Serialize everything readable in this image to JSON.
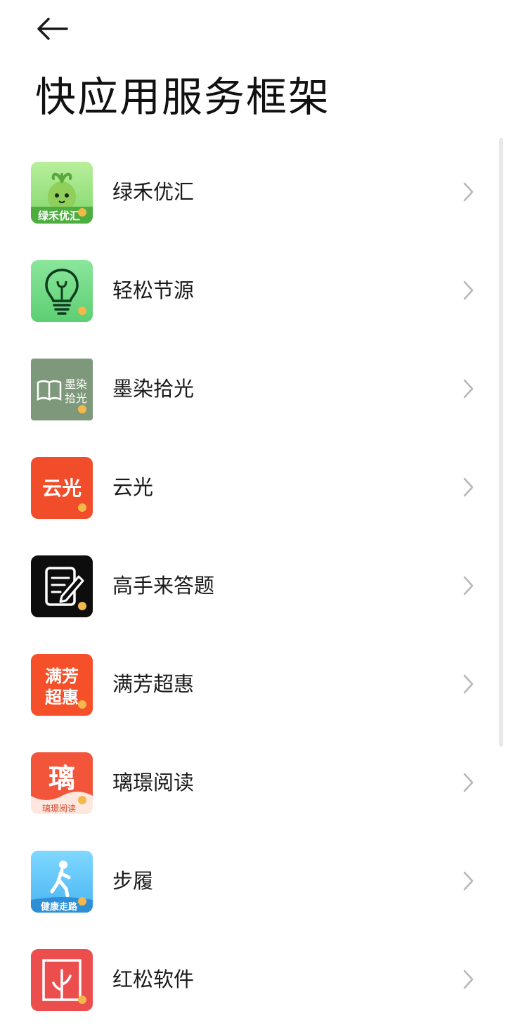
{
  "header": {
    "back_icon": "arrow-left-icon",
    "title": "快应用服务框架"
  },
  "apps": [
    {
      "label": "绿禾优汇",
      "icon_text": "绿禾优汇",
      "colors": {
        "bg": "#5fc46a",
        "bg2": "#8fd977"
      }
    },
    {
      "label": "轻松节源",
      "icon_text": "",
      "colors": {
        "bg": "#7ee08f",
        "bg2": "#59cd6f"
      }
    },
    {
      "label": "墨染拾光",
      "icon_text_line1": "墨染",
      "icon_text_line2": "拾光",
      "colors": {
        "bg": "#7d987a"
      }
    },
    {
      "label": "云光",
      "icon_text": "云光",
      "colors": {
        "bg": "#f24d2a"
      }
    },
    {
      "label": "高手来答题",
      "icon_text": "",
      "colors": {
        "bg": "#0d0d0d"
      }
    },
    {
      "label": "满芳超惠",
      "icon_text_line1": "满芳",
      "icon_text_line2": "超惠",
      "colors": {
        "bg": "#f5502a"
      }
    },
    {
      "label": "璃璟阅读",
      "icon_text": "璃",
      "icon_subtext": "璃璟阅读",
      "colors": {
        "bg": "#fde7de",
        "top": "#f2553a"
      }
    },
    {
      "label": "步履",
      "icon_subtext": "健康走路",
      "colors": {
        "bg": "#4db8f5",
        "bg2": "#6ed0ff"
      }
    },
    {
      "label": "红松软件",
      "icon_text": "",
      "colors": {
        "bg": "#ec4d4d"
      }
    }
  ],
  "chevron_icon": "chevron-right-icon",
  "badge_icon": "quick-app-link-badge-icon"
}
